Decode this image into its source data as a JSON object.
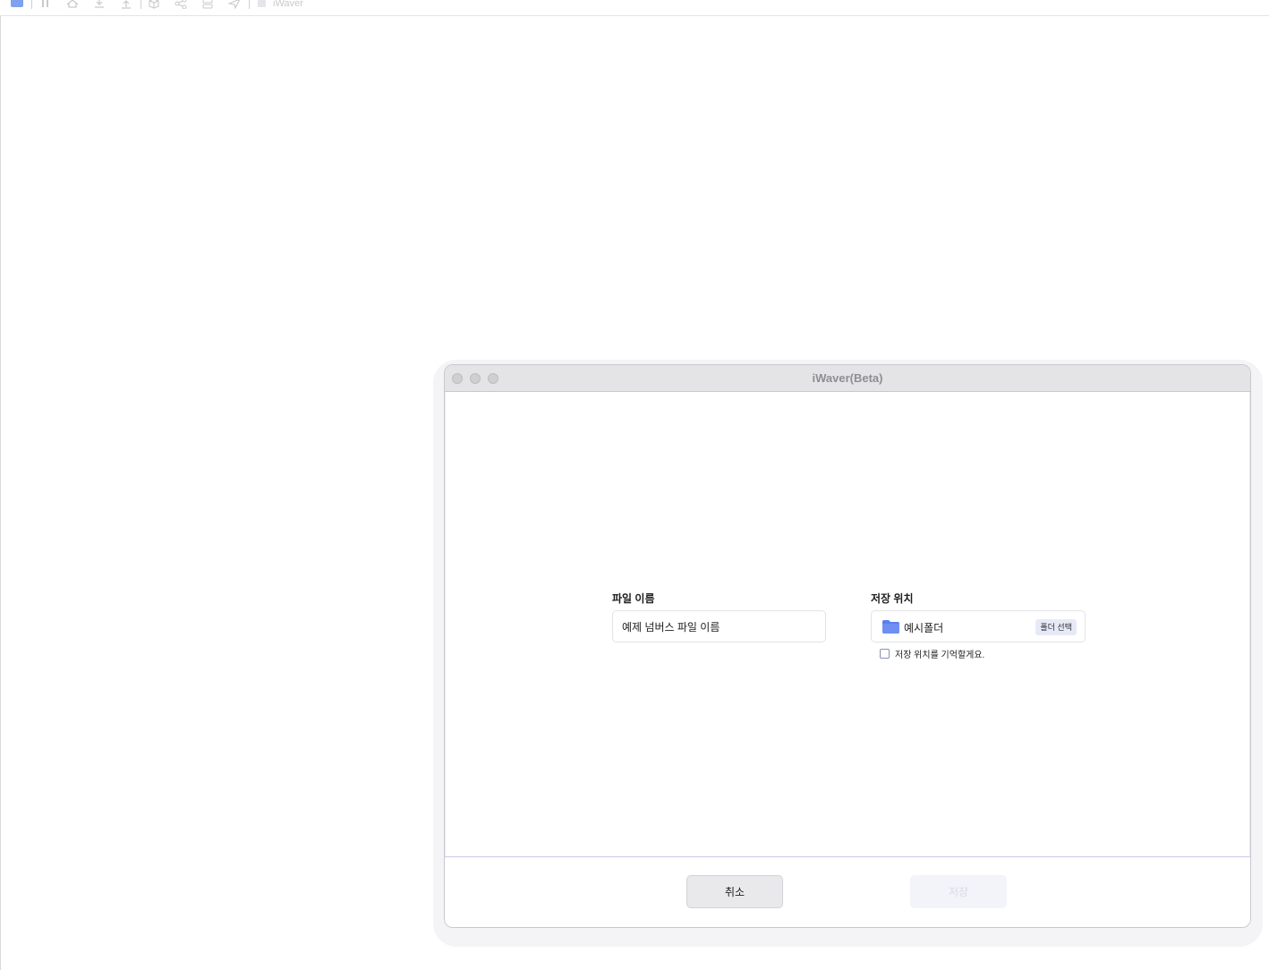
{
  "background_app": {
    "title": "iWaver",
    "toolbar_icons": [
      "folder-icon",
      "pause-icon",
      "home-icon",
      "download-icon",
      "upload-icon",
      "cube-icon",
      "share-icon",
      "layers-icon",
      "send-icon"
    ]
  },
  "dialog": {
    "window_title": "iWaver(Beta)",
    "file_name_label": "파일 이름",
    "file_name_value": "예제 넘버스 파일 이름",
    "save_location_label": "저장 위치",
    "folder_name": "예시폴더",
    "folder_select_button": "폴더 선택",
    "remember_location_label": "저장 위치를 기억할게요.",
    "remember_checked": false,
    "cancel_button": "취소",
    "save_button": "저장"
  },
  "colors": {
    "accent_folder": "#5b7ef0",
    "folder_button_bg": "#e7eaf6",
    "disabled_save_bg": "#f3f4fa"
  }
}
